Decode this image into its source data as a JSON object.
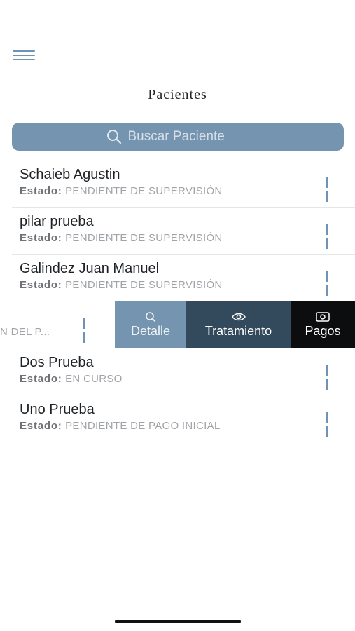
{
  "header": {
    "title": "Pacientes"
  },
  "search": {
    "placeholder": "Buscar Paciente"
  },
  "status_label": "Estado:",
  "patients": [
    {
      "name": "Schaieb Agustin",
      "status": "PENDIENTE DE SUPERVISIÓN"
    },
    {
      "name": "pilar prueba",
      "status": "PENDIENTE DE SUPERVISIÓN"
    },
    {
      "name": "Galindez Juan Manuel",
      "status": "PENDIENTE DE SUPERVISIÓN"
    },
    {
      "name": "",
      "status": "ON DEL P..."
    },
    {
      "name": "Dos Prueba",
      "status": "EN CURSO"
    },
    {
      "name": "Uno Prueba",
      "status": "PENDIENTE DE PAGO INICIAL"
    }
  ],
  "swipe_actions": {
    "detalle": "Detalle",
    "tratamiento": "Tratamiento",
    "pagos": "Pagos"
  },
  "colors": {
    "accent": "#7494b0",
    "dark_slate": "#33495c",
    "black": "#0c0d0f"
  }
}
